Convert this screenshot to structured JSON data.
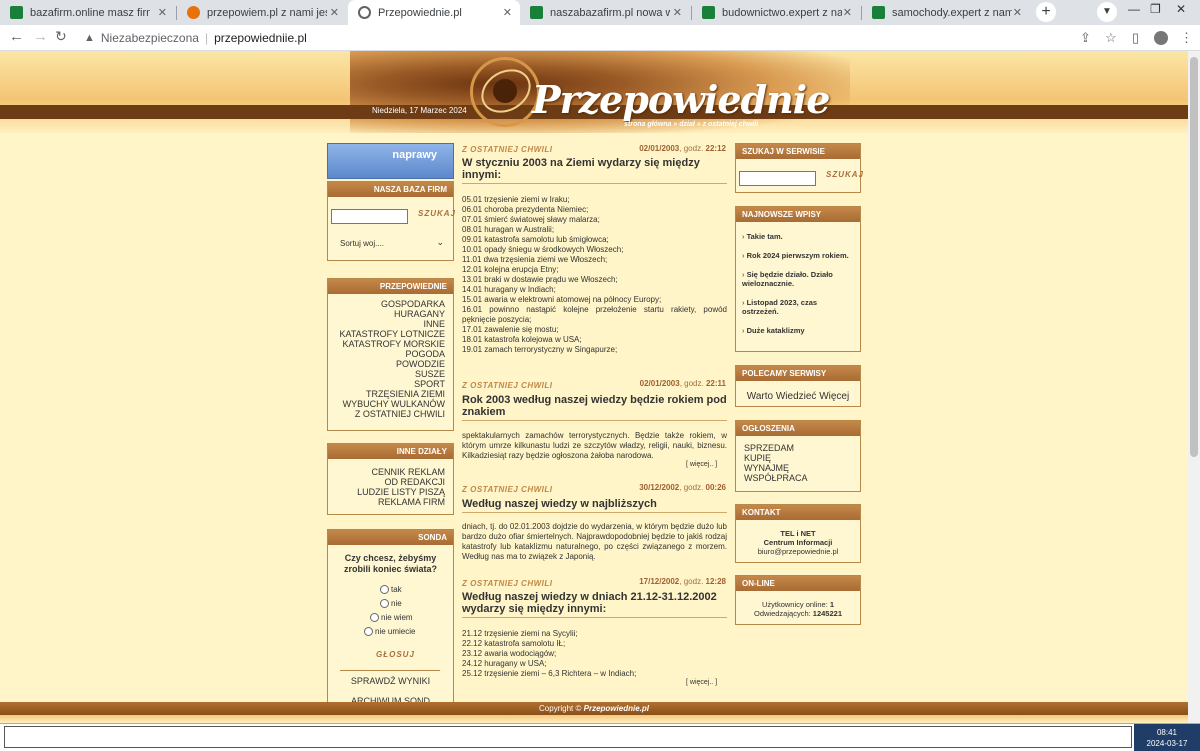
{
  "browser": {
    "tabs": [
      {
        "title": "bazafirm.online masz firmę kup",
        "favicon_color": "#188038",
        "active": false
      },
      {
        "title": "przepowiem.pl z nami jesteś zn",
        "favicon_color": "#e8710a",
        "active": false
      },
      {
        "title": "Przepowiednie.pl",
        "favicon_color": "#5f6368",
        "active": true
      },
      {
        "title": "naszabazafirm.pl nowa wyszukiw",
        "favicon_color": "#188038",
        "active": false
      },
      {
        "title": "budownictwo.expert z nami jeste",
        "favicon_color": "#188038",
        "active": false
      },
      {
        "title": "samochody.expert z nami jesteś",
        "favicon_color": "#188038",
        "active": false
      }
    ],
    "new_tab_label": "+",
    "security_label": "Niezabezpieczona",
    "url": "przepowiedniie.pl"
  },
  "header": {
    "date": "Niedziela, 17 Marzec 2024",
    "logo": "Przepowiednie",
    "breadcrumbs": "strona główna » dział » z ostatniej chwili"
  },
  "left": {
    "naprawy_label": "naprawy",
    "baza_firm": {
      "title": "NASZA BAZA FIRM",
      "search_label": "SZUKAJ",
      "sort_placeholder": "Sortuj woj...."
    },
    "przepowiednie": {
      "title": "PRZEPOWIEDNIE",
      "items": [
        "GOSPODARKA",
        "HURAGANY",
        "INNE",
        "KATASTROFY LOTNICZE",
        "KATASTROFY MORSKIE",
        "POGODA",
        "POWODZIE",
        "SUSZE",
        "SPORT",
        "TRZĘSIENIA ZIEMI",
        "WYBUCHY WULKANÓW",
        "Z OSTATNIEJ CHWILI"
      ]
    },
    "inne_dzialy": {
      "title": "INNE DZIAŁY",
      "items": [
        "CENNIK REKLAM",
        "OD REDAKCJI",
        "LUDZIE LISTY PISZĄ",
        "REKLAMA FIRM"
      ]
    },
    "sonda": {
      "title": "SONDA",
      "question": "Czy chcesz, żebyśmy zrobili koniec świata?",
      "options": [
        "tak",
        "nie",
        "nie wiem",
        "nie umiecie"
      ],
      "vote_label": "GŁOSUJ",
      "results_label": "SPRAWDŹ WYNIKI",
      "archive_label": "ARCHIWUM SOND"
    }
  },
  "articles": [
    {
      "category": "Z OSTATNIEJ CHWILI",
      "date": "02/01/2003",
      "time_label": "godz.",
      "time": "22:12",
      "title": "W styczniu 2003 na Ziemi wydarzy się między innymi:",
      "lines": [
        "05.01 trzęsienie ziemi w Iraku;",
        "06.01 choroba prezydenta Niemiec;",
        "07.01 śmierć światowej sławy malarza;",
        "08.01 huragan w Australii;",
        "09.01 katastrofa samolotu lub śmigłowca;",
        "10.01 opady śniegu w środkowych Włoszech;",
        "11.01 dwa trzęsienia ziemi we Włoszech;",
        "12.01 kolejna erupcja Etny;",
        "13.01 braki w dostawie prądu we Włoszech;",
        "14.01 huragany w Indiach;",
        "15.01 awaria w elektrowni atomowej na północy Europy;",
        "16.01 powinno nastąpić kolejne przełożenie startu rakiety, powód pęknięcie poszycia;",
        "17.01 zawalenie się mostu;",
        "18.01 katastrofa kolejowa w USA;",
        "19.01 zamach terrorystyczny w Singapurze;"
      ]
    },
    {
      "category": "Z OSTATNIEJ CHWILI",
      "date": "02/01/2003",
      "time_label": "godz.",
      "time": "22:11",
      "title": "Rok 2003 według naszej wiedzy będzie rokiem pod znakiem",
      "body": "spektakularnych zamachów terrorystycznych. Będzie także rokiem, w którym umrze kilkunastu ludzi ze szczytów władzy, religii, nauki, biznesu. Kilkadziesiąt razy będzie ogłoszona żałoba narodowa.",
      "more": "[ więcej.. ]"
    },
    {
      "category": "Z OSTATNIEJ CHWILI",
      "date": "30/12/2002",
      "time_label": "godz.",
      "time": "00:26",
      "title": "Według naszej wiedzy w najbliższych",
      "body": "dniach, tj. do 02.01.2003 dojdzie do wydarzenia, w którym będzie dużo lub bardzo dużo ofiar śmiertelnych. Najprawdopodobniej będzie to jakiś rodzaj katastrofy lub kataklizmu naturalnego, po części związanego z morzem. Według nas ma to związek z Japonią."
    },
    {
      "category": "Z OSTATNIEJ CHWILI",
      "date": "17/12/2002",
      "time_label": "godz.",
      "time": "12:28",
      "title": "Według naszej wiedzy w dniach 21.12-31.12.2002 wydarzy się między innymi:",
      "lines": [
        "21.12 trzęsienie ziemi na Sycylii;",
        "22.12 katastrofa samolotu IŁ;",
        "23.12 awaria wodociągów;",
        "24.12 huragany w USA;",
        "25.12 trzęsienie ziemi – 6,3 Richtera – w Indiach;"
      ],
      "more": "[ więcej.. ]"
    }
  ],
  "right": {
    "search": {
      "title": "SZUKAJ W SERWISIE",
      "button": "SZUKAJ"
    },
    "newest": {
      "title": "NAJNOWSZE WPISY",
      "items": [
        "Takie tam.",
        "Rok 2024 pierwszym rokiem.",
        "Się będzie działo. Działo wieloznacznie.",
        "Listopad 2023, czas ostrzeżeń.",
        "Duże kataklizmy"
      ]
    },
    "polecamy": {
      "title": "POLECAMY SERWISY",
      "item": "Warto Wiedzieć Więcej"
    },
    "ogloszenia": {
      "title": "OGŁOSZENIA",
      "items": [
        "SPRZEDAM",
        "KUPIĘ",
        "WYNAJMĘ",
        "WSPÓŁPRACA"
      ]
    },
    "kontakt": {
      "title": "KONTAKT",
      "line1": "TEL i NET",
      "line2": "Centrum Informacji",
      "email": "biuro@przepowiednie.pl"
    },
    "online": {
      "title": "ON-LINE",
      "users_label": "Użytkownicy online:",
      "users": "1",
      "visits_label": "Odwiedzających:",
      "visits": "1245221"
    }
  },
  "footer": {
    "copyright": "Copyright ©",
    "brand": "Przepowiednie.pl"
  },
  "taskbar": {
    "time": "08:41",
    "date": "2024-03-17"
  }
}
